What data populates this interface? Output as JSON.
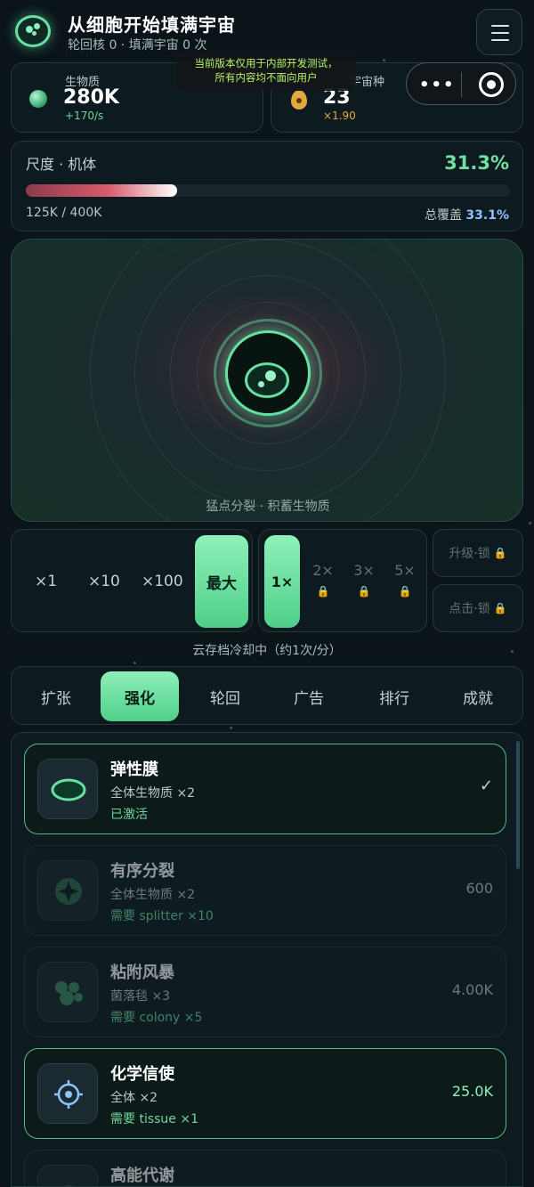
{
  "header": {
    "title": "从细胞开始填满宇宙",
    "subtitle": "轮回核 0 · 填满宇宙 0 次",
    "menu_icon": "hamburger-menu-icon"
  },
  "notice": {
    "line1": "当前版本仅用于内部开发测试，",
    "line2": "所有内容均不面向用户"
  },
  "stats": {
    "biomass_label": "生物质",
    "biomass_value": "280K",
    "biomass_rate": "+170/s",
    "seed_label": "宇宙种",
    "seed_value": "23",
    "seed_mult": "×1.90"
  },
  "capsule": {
    "more_icon": "more-dots-icon",
    "close_icon": "target-close-icon",
    "more_glyph": "•••"
  },
  "scale": {
    "label": "尺度 · 机体",
    "percent": "31.3%",
    "progress_fraction": 0.313,
    "count": "125K / 400K",
    "cover_label": "总覆盖",
    "cover_value": "33.1%"
  },
  "arena": {
    "hint": "猛点分裂 · 积蓄生物质"
  },
  "buy": {
    "options": [
      "×1",
      "×10",
      "×100"
    ],
    "max_label": "最大"
  },
  "speed": {
    "active": "1×",
    "locked": [
      "2×",
      "3×",
      "5×"
    ],
    "lock_glyph": "🔒"
  },
  "side": {
    "upgrade_label": "升级·锁",
    "click_label": "点击·锁"
  },
  "cloud_note": "云存档冷却中（约1次/分）",
  "tabs": [
    "扩张",
    "强化",
    "轮回",
    "广告",
    "排行",
    "成就"
  ],
  "active_tab": "强化",
  "upgrades": [
    {
      "name": "弹性膜",
      "desc": "全体生物质 ×2",
      "status": "已激活",
      "cost": "",
      "icon": "membrane-icon"
    },
    {
      "name": "有序分裂",
      "desc": "全体生物质 ×2",
      "status": "需要 splitter ×10",
      "cost": "600",
      "icon": "split-star-icon"
    },
    {
      "name": "粘附风暴",
      "desc": "菌落毯 ×3",
      "status": "需要 colony ×5",
      "cost": "4.00K",
      "icon": "cluster-icon"
    },
    {
      "name": "化学信使",
      "desc": "全体 ×2",
      "status": "需要 tissue ×1",
      "cost": "25.0K",
      "icon": "crosshair-icon"
    },
    {
      "name": "高能代谢",
      "desc": "",
      "status": "",
      "cost": "",
      "icon": "metabolism-icon"
    }
  ],
  "colors": {
    "accent": "#66e0a3",
    "background": "#0a1419",
    "warning": "#d4a437",
    "cover_blue": "#8ec3ff"
  }
}
